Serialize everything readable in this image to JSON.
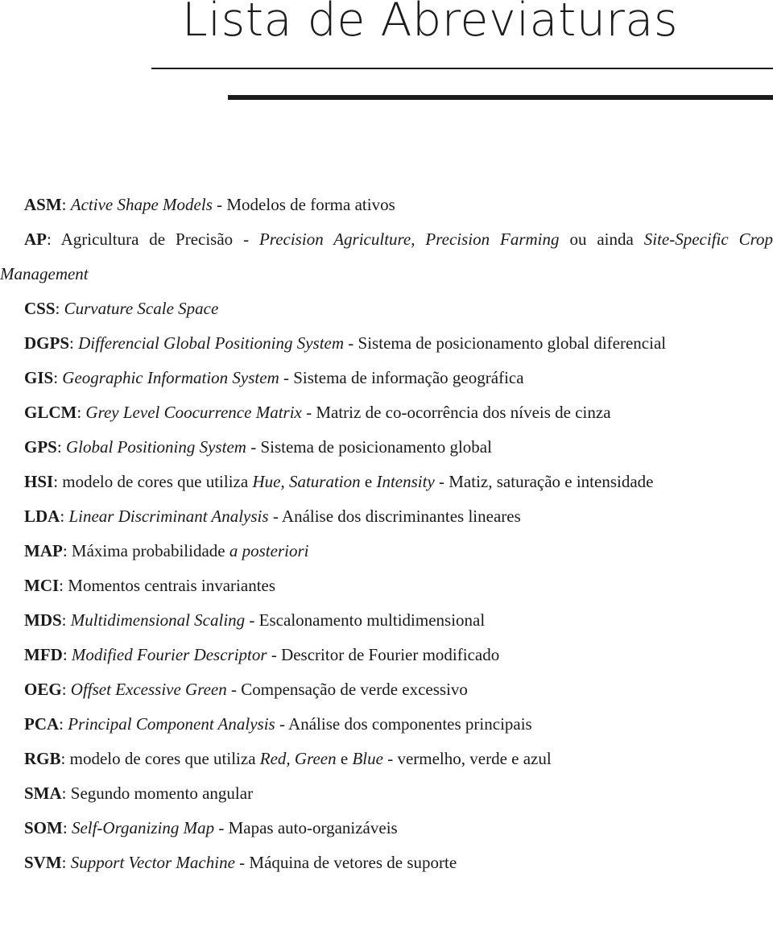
{
  "document": {
    "title": "Lista de Abreviaturas"
  },
  "rules": {
    "thin_color": "#1c1c1c",
    "thick_color": "#1c1c1c"
  },
  "abbreviations": [
    {
      "term": "ASM",
      "separator": ": ",
      "english": "Active Shape Models",
      "dash": " - ",
      "portuguese": "Modelos de forma ativos",
      "wraps": false
    },
    {
      "term": "AP",
      "separator": ": ",
      "english": "",
      "dash": "",
      "portuguese": "Agricultura de Precisão - ",
      "english_2": "Precision Agriculture, Precision Farming",
      "portuguese_2": " ou ainda ",
      "english_3": "Site-Specific Crop Management",
      "wraps": true
    },
    {
      "term": "CSS",
      "separator": ": ",
      "english": "Curvature Scale Space",
      "dash": "",
      "portuguese": "",
      "wraps": false
    },
    {
      "term": "DGPS",
      "separator": ": ",
      "english": "Differencial Global Positioning System",
      "dash": " - ",
      "portuguese": "Sistema de posicionamento global diferencial",
      "wraps": true
    },
    {
      "term": "GIS",
      "separator": ": ",
      "english": "Geographic Information System",
      "dash": " - ",
      "portuguese": "Sistema de informação geográfica",
      "wraps": false
    },
    {
      "term": "GLCM",
      "separator": ": ",
      "english": "Grey Level Coocurrence Matrix",
      "dash": " - ",
      "portuguese": "Matriz de co-ocorrência dos níveis de cinza",
      "wraps": false
    },
    {
      "term": "GPS",
      "separator": ": ",
      "english": "Global Positioning System",
      "dash": " - ",
      "portuguese": "Sistema de posicionamento global",
      "wraps": false
    },
    {
      "term": "HSI",
      "separator": ": ",
      "english": "",
      "dash": "",
      "portuguese": "modelo de cores que utiliza ",
      "english_2": "Hue, Saturation",
      "portuguese_2": " e ",
      "english_3": "Intensity",
      "portuguese_3": " - Matiz, saturação e intensidade",
      "wraps": true
    },
    {
      "term": "LDA",
      "separator": ": ",
      "english": "Linear Discriminant Analysis",
      "dash": " - ",
      "portuguese": "Análise dos discriminantes lineares",
      "wraps": false
    },
    {
      "term": "MAP",
      "separator": ": ",
      "english": "",
      "dash": "",
      "portuguese": "Máxima probabilidade ",
      "english_2": "a posteriori",
      "wraps": false
    },
    {
      "term": "MCI",
      "separator": ": ",
      "english": "",
      "dash": "",
      "portuguese": "Momentos centrais invariantes",
      "wraps": false
    },
    {
      "term": "MDS",
      "separator": ": ",
      "english": "Multidimensional Scaling",
      "dash": " - ",
      "portuguese": "Escalonamento multidimensional",
      "wraps": false
    },
    {
      "term": "MFD",
      "separator": ": ",
      "english": "Modified Fourier Descriptor",
      "dash": " - ",
      "portuguese": "Descritor de Fourier modificado",
      "wraps": false
    },
    {
      "term": "OEG",
      "separator": ": ",
      "english": "Offset Excessive Green",
      "dash": " - ",
      "portuguese": "Compensação de verde excessivo",
      "wraps": false
    },
    {
      "term": "PCA",
      "separator": ": ",
      "english": "Principal Component Analysis",
      "dash": " - ",
      "portuguese": "Análise dos componentes principais",
      "wraps": false
    },
    {
      "term": "RGB",
      "separator": ": ",
      "english": "",
      "dash": "",
      "portuguese": "modelo de cores que utiliza ",
      "english_2": "Red, Green",
      "portuguese_2": " e ",
      "english_3": "Blue",
      "portuguese_3": " - vermelho, verde e azul",
      "wraps": false
    },
    {
      "term": "SMA",
      "separator": ": ",
      "english": "",
      "dash": "",
      "portuguese": "Segundo momento angular",
      "wraps": false
    },
    {
      "term": "SOM",
      "separator": ": ",
      "english": "Self-Organizing Map",
      "dash": " - ",
      "portuguese": "Mapas auto-organizáveis",
      "wraps": false
    },
    {
      "term": "SVM",
      "separator": ": ",
      "english": "Support Vector Machine",
      "dash": " - ",
      "portuguese": "Máquina de vetores de suporte",
      "wraps": false
    }
  ]
}
